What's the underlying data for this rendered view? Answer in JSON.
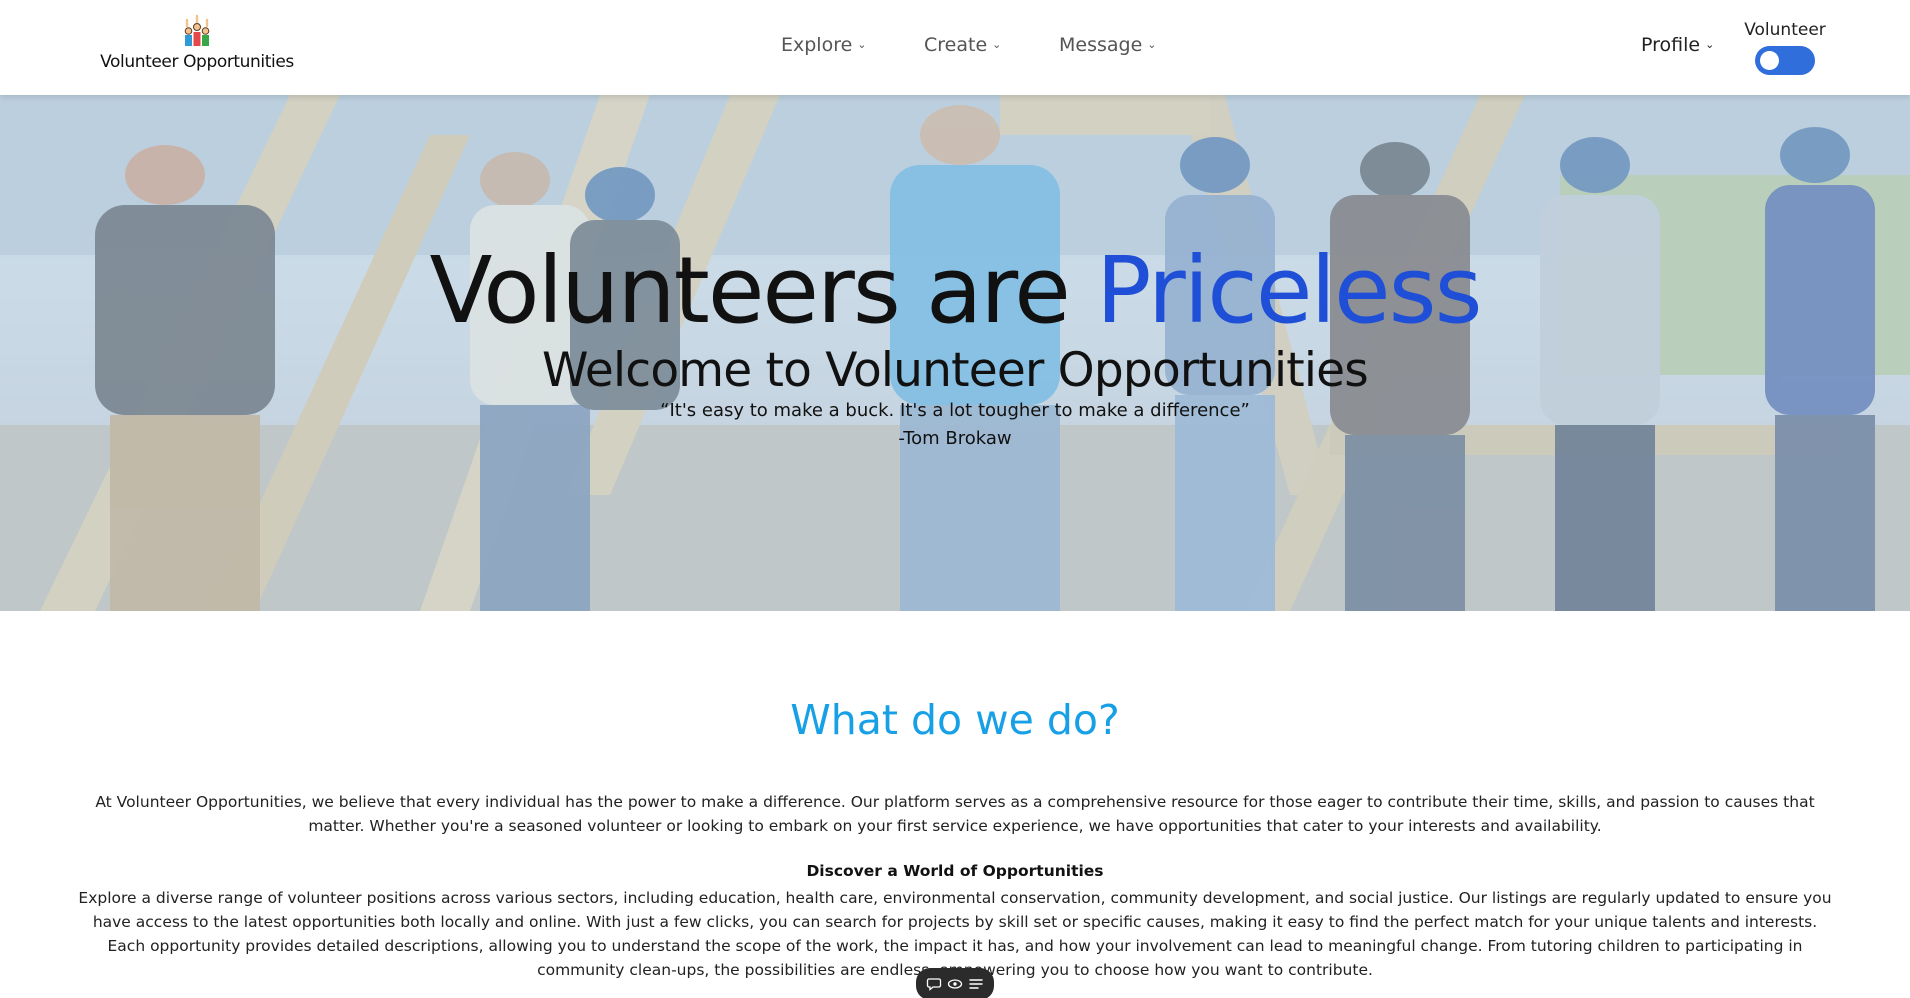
{
  "brand": {
    "name": "Volunteer Opportunities",
    "logo_icon": "volunteers-group-icon"
  },
  "nav": {
    "items": [
      {
        "label": "Explore",
        "icon": "chevron-down-icon"
      },
      {
        "label": "Create",
        "icon": "chevron-down-icon"
      },
      {
        "label": "Message",
        "icon": "chevron-down-icon"
      }
    ],
    "profile": {
      "label": "Profile",
      "icon": "chevron-down-icon"
    },
    "mode_toggle": {
      "label": "Volunteer",
      "state": "on",
      "color": "#2f6edb"
    }
  },
  "hero": {
    "title_prefix": "Volunteers are ",
    "title_accent": "Priceless",
    "accent_color": "#1f4fd6",
    "subtitle": "Welcome to Volunteer Opportunities",
    "quote": "“It's easy to make a buck. It's a lot tougher to make a difference”",
    "author": "-Tom Brokaw"
  },
  "about": {
    "title": "What do we do?",
    "title_color": "#18a0e6",
    "intro": "At Volunteer Opportunities, we believe that every individual has the power to make a difference. Our platform serves as a comprehensive resource for those eager to contribute their time, skills, and passion to causes that matter. Whether you're a seasoned volunteer or looking to embark on your first service experience, we have opportunities that cater to your interests and availability.",
    "discover_heading": "Discover a World of Opportunities",
    "discover_text": "Explore a diverse range of volunteer positions across various sectors, including education, health care, environmental conservation, community development, and social justice. Our listings are regularly updated to ensure you have access to the latest opportunities both locally and online. With just a few clicks, you can search for projects by skill set or specific causes, making it easy to find the perfect match for your unique talents and interests. Each opportunity provides detailed descriptions, allowing you to understand the scope of the work, the impact it has, and how your involvement can lead to meaningful change. From tutoring children to participating in community clean-ups, the possibilities are endless, empowering you to choose how you want to contribute."
  },
  "floating_toolbar": {
    "icons": [
      "comment-icon",
      "eye-icon",
      "list-icon"
    ]
  }
}
